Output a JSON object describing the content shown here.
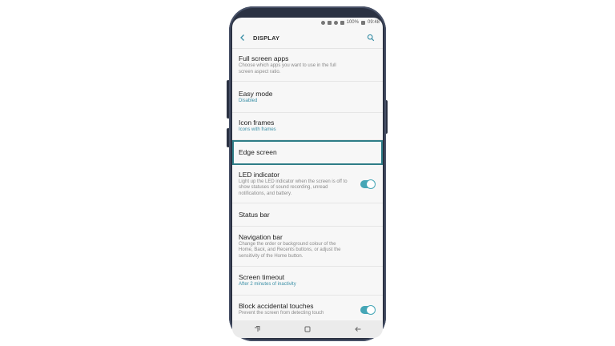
{
  "status_bar": {
    "battery": "100%",
    "time": "09:48"
  },
  "header": {
    "title": "DISPLAY"
  },
  "settings": [
    {
      "title": "Full screen apps",
      "subtitle": "Choose which apps you want to use in the full screen aspect ratio.",
      "accent": false,
      "toggle": false,
      "highlighted": false
    },
    {
      "title": "Easy mode",
      "subtitle": "Disabled",
      "accent": true,
      "toggle": false,
      "highlighted": false
    },
    {
      "title": "Icon frames",
      "subtitle": "Icons with frames",
      "accent": true,
      "toggle": false,
      "highlighted": false
    },
    {
      "title": "Edge screen",
      "subtitle": "",
      "accent": false,
      "toggle": false,
      "highlighted": true
    },
    {
      "title": "LED indicator",
      "subtitle": "Light up the LED indicator when the screen is off to show statuses of sound recording, unread notifications, and battery.",
      "accent": false,
      "toggle": true,
      "toggle_on": true,
      "highlighted": false
    },
    {
      "title": "Status bar",
      "subtitle": "",
      "accent": false,
      "toggle": false,
      "highlighted": false
    },
    {
      "title": "Navigation bar",
      "subtitle": "Change the order or background colour of the Home, Back, and Recents buttons, or adjust the sensitivity of the Home button.",
      "accent": false,
      "toggle": false,
      "highlighted": false
    },
    {
      "title": "Screen timeout",
      "subtitle": "After 2 minutes of inactivity",
      "accent": true,
      "toggle": false,
      "highlighted": false
    },
    {
      "title": "Block accidental touches",
      "subtitle": "Prevent the screen from detecting touch",
      "accent": false,
      "toggle": true,
      "toggle_on": true,
      "highlighted": false
    }
  ],
  "nav": {
    "icons": [
      "recents-icon",
      "home-icon",
      "back-icon"
    ]
  },
  "colors": {
    "accent": "#3a8fa6",
    "highlight": "#2e7d87",
    "toggle": "#45a6b6"
  }
}
